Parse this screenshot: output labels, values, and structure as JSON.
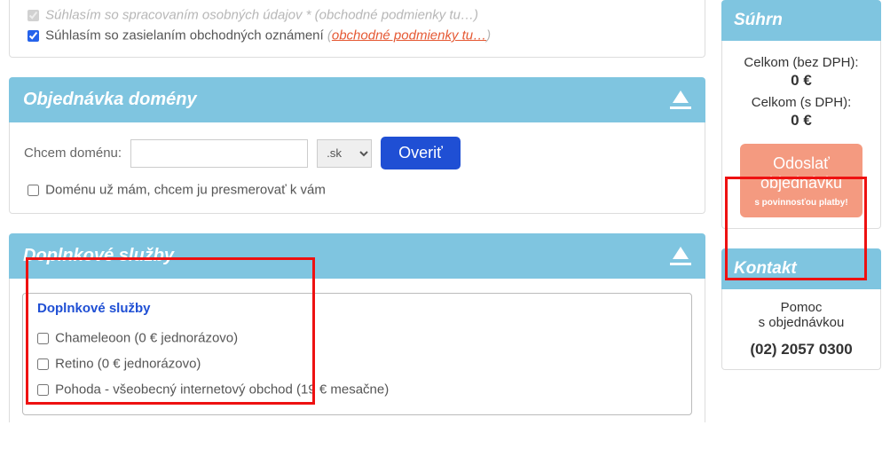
{
  "top": {
    "personal_data_label": "Súhlasím so spracovaním osobných údajov * (obchodné podmienky tu…)",
    "marketing_label": "Súhlasím so zasielaním obchodných oznámení",
    "terms_paren_open": "  (",
    "terms_link": "obchodné podmienky tu…",
    "terms_paren_close": ")"
  },
  "domain_panel": {
    "title": "Objednávka domény",
    "want_label": "Chcem doménu:",
    "domain_value": "",
    "tld_selected": ".sk",
    "verify_label": "Overiť",
    "redirect_label": "Doménu už mám, chcem ju presmerovať k vám"
  },
  "addons_panel": {
    "title": "Doplnkové služby",
    "group_legend": "Doplnkové služby",
    "items": [
      {
        "label": "Chameleoon (0 € jednorázovo)"
      },
      {
        "label": "Retino (0 € jednorázovo)"
      },
      {
        "label": "Pohoda - všeobecný internetový obchod (19 € mesačne)"
      }
    ]
  },
  "summary": {
    "title": "Súhrn",
    "subtotal_label": "Celkom (bez DPH):",
    "subtotal_value": "0 €",
    "total_label": "Celkom (s DPH):",
    "total_value": "0 €",
    "submit_line1": "Odoslať",
    "submit_line2": "objednávku",
    "submit_note": "s povinnosťou platby!"
  },
  "contact": {
    "title": "Kontakt",
    "help_line1": "Pomoc",
    "help_line2": "s objednávkou",
    "phone": "(02) 2057 0300"
  }
}
